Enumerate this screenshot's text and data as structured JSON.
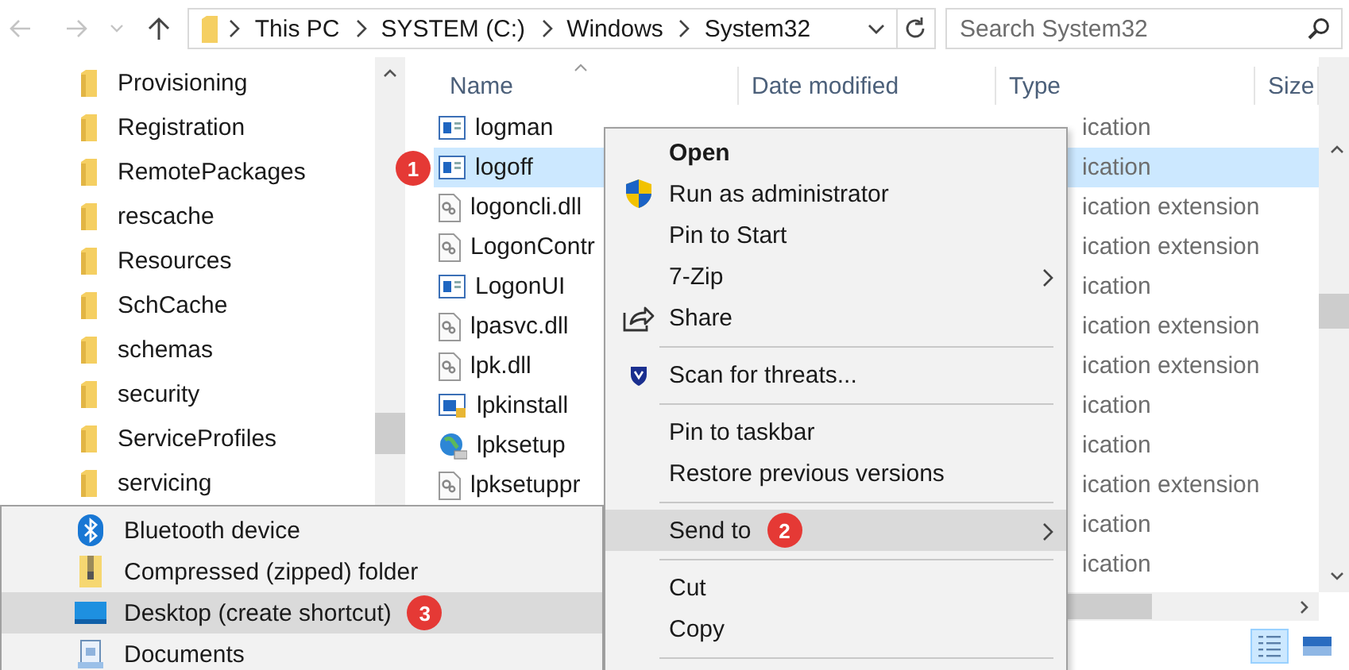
{
  "toolbar": {
    "breadcrumbs": [
      "This PC",
      "SYSTEM (C:)",
      "Windows",
      "System32"
    ],
    "search": {
      "placeholder": "Search System32"
    }
  },
  "nav_pane": {
    "items": [
      "Provisioning",
      "Registration",
      "RemotePackages",
      "rescache",
      "Resources",
      "SchCache",
      "schemas",
      "security",
      "ServiceProfiles",
      "servicing"
    ]
  },
  "file_list": {
    "columns": [
      "Name",
      "Date modified",
      "Type",
      "Size"
    ],
    "rows": [
      {
        "kind": "application",
        "name": "logman",
        "type": "ication",
        "selected": false
      },
      {
        "kind": "application",
        "name": "logoff",
        "type": "ication",
        "selected": true,
        "badge": "1"
      },
      {
        "kind": "library",
        "name": "logoncli.dll",
        "type": "ication extension",
        "selected": false
      },
      {
        "kind": "library",
        "name": "LogonContr",
        "type": "ication extension",
        "selected": false
      },
      {
        "kind": "application",
        "name": "LogonUI",
        "type": "ication",
        "selected": false
      },
      {
        "kind": "library",
        "name": "lpasvc.dll",
        "type": "ication extension",
        "selected": false
      },
      {
        "kind": "library",
        "name": "lpk.dll",
        "type": "ication extension",
        "selected": false
      },
      {
        "kind": "installer",
        "name": "lpkinstall",
        "type": "ication",
        "selected": false
      },
      {
        "kind": "setup",
        "name": "lpksetup",
        "type": "ication",
        "selected": false
      },
      {
        "kind": "library",
        "name": "lpksetuppr",
        "type": "ication extension",
        "selected": false
      },
      {
        "kind": "covered",
        "type": "ication",
        "selected": false
      },
      {
        "kind": "covered",
        "type": "ication",
        "selected": false
      }
    ]
  },
  "context_menu": {
    "items": [
      {
        "kind": "item",
        "label": "Open",
        "default": true,
        "submenu": false,
        "selected": false
      },
      {
        "kind": "admin",
        "label": "Run as administrator",
        "default": false,
        "submenu": false,
        "selected": false
      },
      {
        "kind": "item",
        "label": "Pin to Start",
        "default": false,
        "submenu": false,
        "selected": false
      },
      {
        "kind": "item",
        "label": "7-Zip",
        "default": false,
        "submenu": true,
        "selected": false
      },
      {
        "kind": "share",
        "label": "Share",
        "default": false,
        "submenu": false,
        "selected": false
      },
      {
        "kind": "separator"
      },
      {
        "kind": "scan",
        "label": "Scan for threats...",
        "default": false,
        "submenu": false,
        "selected": false
      },
      {
        "kind": "separator"
      },
      {
        "kind": "item",
        "label": "Pin to taskbar",
        "default": false,
        "submenu": false,
        "selected": false
      },
      {
        "kind": "item",
        "label": "Restore previous versions",
        "default": false,
        "submenu": false,
        "selected": false
      },
      {
        "kind": "separator"
      },
      {
        "kind": "item",
        "label": "Send to",
        "default": false,
        "submenu": true,
        "selected": true,
        "badge": "2"
      },
      {
        "kind": "separator"
      },
      {
        "kind": "item",
        "label": "Cut",
        "default": false,
        "submenu": false,
        "selected": false
      },
      {
        "kind": "item",
        "label": "Copy",
        "default": false,
        "submenu": false,
        "selected": false
      },
      {
        "kind": "separator"
      }
    ]
  },
  "send_to_menu": {
    "items": [
      {
        "kind": "bluetooth",
        "label": "Bluetooth device",
        "selected": false
      },
      {
        "kind": "zip",
        "label": "Compressed (zipped) folder",
        "selected": false
      },
      {
        "kind": "desktop",
        "label": "Desktop (create shortcut)",
        "selected": true,
        "badge": "3"
      },
      {
        "kind": "documents",
        "label": "Documents",
        "selected": false
      }
    ]
  },
  "status_bar": {
    "views": [
      {
        "kind": "details",
        "selected": true
      },
      {
        "kind": "large_icons",
        "selected": false
      }
    ]
  }
}
